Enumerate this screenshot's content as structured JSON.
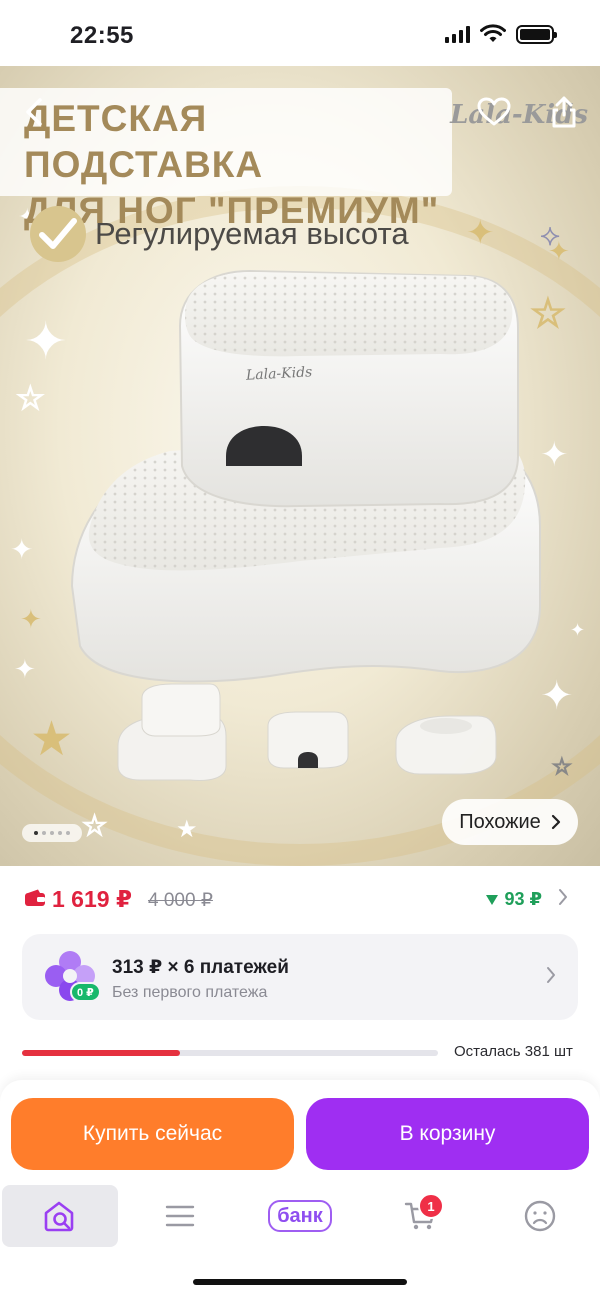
{
  "status_bar": {
    "time": "22:55"
  },
  "hero": {
    "title_line1": "ДЕТСКАЯ ПОДСТАВКА",
    "title_line2": "ДЛЯ НОГ \"ПРЕМИУМ\"",
    "brand": "Lala-Kids",
    "feature": "Регулируемая высота",
    "stool_brand": "Lala-Kids",
    "similar_label": "Похожие",
    "gallery": {
      "total": 5,
      "active_index": 0
    }
  },
  "price": {
    "current": "1 619 ₽",
    "old": "4 000 ₽",
    "bonus": "93 ₽"
  },
  "installment": {
    "title": "313 ₽ × 6 платежей",
    "subtitle": "Без первого платежа",
    "badge": "0 ₽"
  },
  "stock": {
    "label": "Осталась 381 шт",
    "fraction": 0.38
  },
  "actions": {
    "buy_now": "Купить сейчас",
    "add_to_cart": "В корзину"
  },
  "tabbar": {
    "bank_label": "банк",
    "cart_count": "1"
  },
  "colors": {
    "accent_purple": "#9f2ef2",
    "accent_orange": "#ff7d2b",
    "price_red": "#e0223f",
    "bonus_green": "#1f9f5a"
  }
}
